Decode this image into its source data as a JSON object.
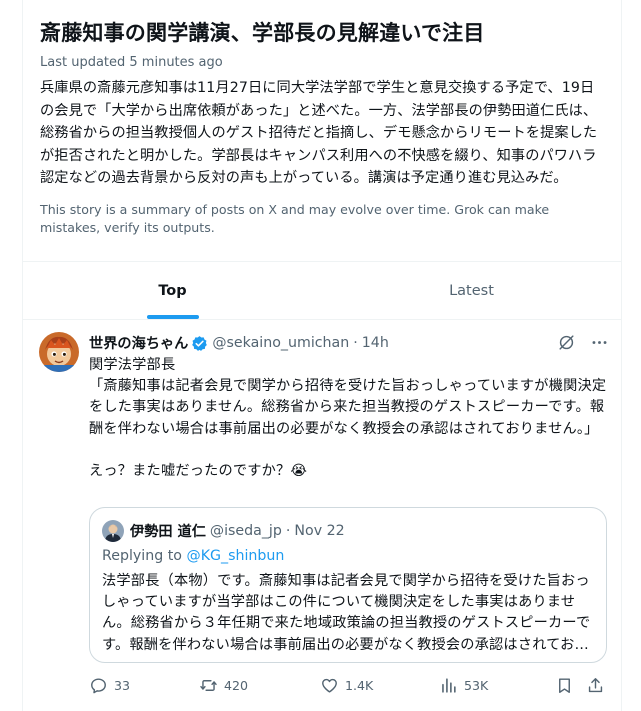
{
  "story": {
    "title": "斎藤知事の関学講演、学部長の見解違いで注目",
    "updated": "Last updated 5 minutes ago",
    "summary": "兵庫県の斎藤元彦知事は11月27日に同大学法学部で学生と意見交換する予定で、19日の会見で「大学から出席依頼があった」と述べた。一方、法学部長の伊勢田道仁氏は、総務省からの担当教授個人のゲスト招待だと指摘し、デモ懸念からリモートを提案したが拒否されたと明かした。学部長はキャンパス利用への不快感を綴り、知事のパワハラ認定などの過去背景から反対の声も上がっている。講演は予定通り進む見込みだ。",
    "disclaimer": "This story is a summary of posts on X and may evolve over time. Grok can make mistakes, verify its outputs."
  },
  "tabs": [
    {
      "label": "Top",
      "active": true
    },
    {
      "label": "Latest",
      "active": false
    }
  ],
  "post": {
    "name": "世界の海ちゃん",
    "handle": "@sekaino_umichan",
    "separator": "·",
    "time": "14h",
    "body": "関学法学部長\n「斎藤知事は記者会見で関学から招待を受けた旨おっしゃっていますが機関決定をした事実はありません。総務省から来た担当教授のゲストスピーカーです。報酬を伴わない場合は事前届出の必要がなく教授会の承認はされておりません。」\n\nえっ？また嘘だったのですか？😭",
    "quote": {
      "name": "伊勢田 道仁",
      "handle": "@iseda_jp",
      "separator": "·",
      "date": "Nov 22",
      "replying_prefix": "Replying to ",
      "replying_to": "@KG_shinbun",
      "text": "法学部長（本物）です。斎藤知事は記者会見で関学から招待を受けた旨おっしゃっていますが当学部はこの件について機関決定をした事実はありません。総務省から３年任期で来た地域政策論の担当教授のゲストスピーカーです。報酬を伴わない場合は事前届出の必要がなく教授会の承認はされておりません。"
    },
    "stats": {
      "replies": "33",
      "reposts": "420",
      "likes": "1.4K",
      "views": "53K"
    }
  },
  "colors": {
    "accent": "#1d9bf0",
    "muted": "#536471",
    "text": "#0f1419",
    "border": "#eff3f4",
    "repost": "#00ba7c"
  },
  "icons": {
    "verified": "verified-badge-icon",
    "grok": "grok-icon",
    "more": "more-icon",
    "reply": "reply-icon",
    "repost": "repost-icon",
    "like": "heart-icon",
    "views": "views-icon",
    "bookmark": "bookmark-icon",
    "share": "share-icon"
  }
}
